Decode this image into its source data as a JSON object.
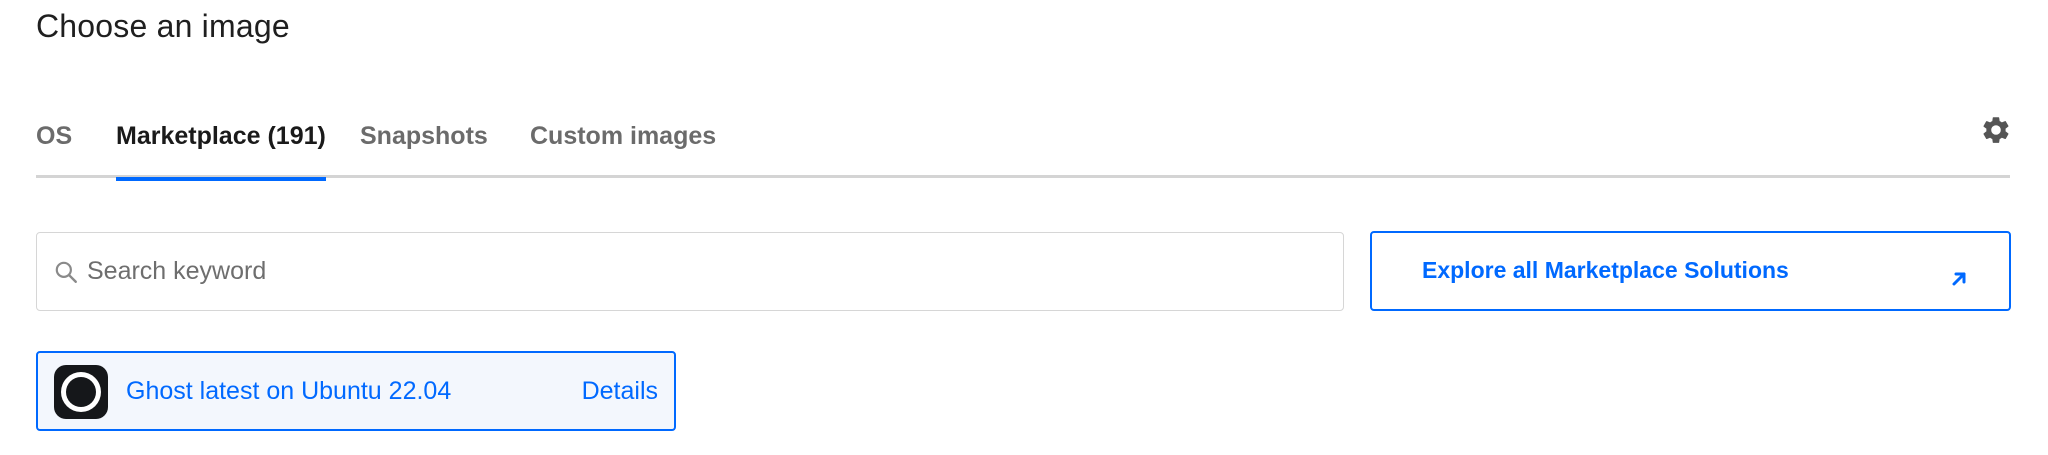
{
  "page": {
    "title": "Choose an image"
  },
  "tabs": [
    {
      "label": "OS",
      "active": false
    },
    {
      "label": "Marketplace (191)",
      "active": true
    },
    {
      "label": "Snapshots",
      "active": false
    },
    {
      "label": "Custom images",
      "active": false
    }
  ],
  "settings": {
    "icon": "gear-icon"
  },
  "search": {
    "placeholder": "Search keyword",
    "value": "",
    "icon": "search-icon"
  },
  "explore": {
    "label": "Explore all Marketplace Solutions",
    "icon": "external-link-arrow-icon"
  },
  "results": [
    {
      "name": "Ghost latest on Ubuntu 22.04",
      "details_label": "Details",
      "logo": "ghost-logo",
      "selected": true
    }
  ],
  "colors": {
    "accent": "#0069ff",
    "card_selected_bg": "#f3f7fd",
    "tab_underline": "#d4d4d4"
  }
}
